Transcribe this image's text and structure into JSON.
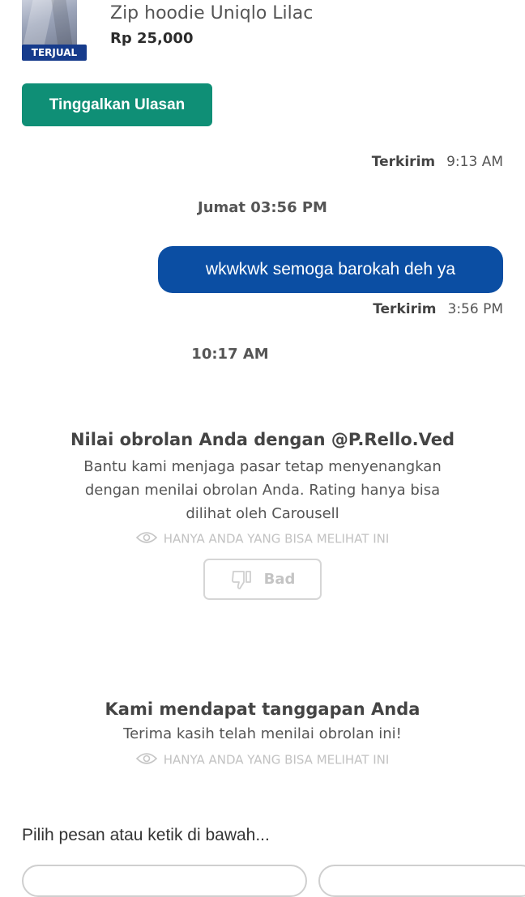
{
  "product": {
    "title": "Zip hoodie Uniqlo Lilac",
    "price": "Rp 25,000",
    "badge": "TERJUAL",
    "image_icon": "hoodie-thumbnail"
  },
  "actions": {
    "review_button": "Tinggalkan Ulasan"
  },
  "messages": {
    "status_1": {
      "status": "Terkirim",
      "time": "9:13 AM"
    },
    "day_separator_1": "Jumat 03:56 PM",
    "bubble_1": {
      "text": "wkwkwk semoga barokah deh ya"
    },
    "status_2": {
      "status": "Terkirim",
      "time": "3:56 PM"
    },
    "day_separator_2": "10:17 AM"
  },
  "rating_card": {
    "title": "Nilai obrolan Anda dengan @P.Rello.Ved",
    "description": "Bantu kami menjaga pasar tetap menyenangkan dengan menilai obrolan Anda. Rating hanya bisa dilihat oleh Carousell",
    "visibility_note": "HANYA ANDA YANG BISA MELIHAT INI",
    "bad_button": "Bad"
  },
  "feedback_card": {
    "title": "Kami mendapat tanggapan Anda",
    "description": "Terima kasih telah menilai obrolan ini!",
    "visibility_note": "HANYA ANDA YANG BISA MELIHAT INI"
  },
  "composer": {
    "prompt": "Pilih pesan atau ketik di bawah..."
  },
  "colors": {
    "accent_green": "#0f8f76",
    "bubble_blue": "#0b4ea3",
    "badge_navy": "#163b8c"
  }
}
